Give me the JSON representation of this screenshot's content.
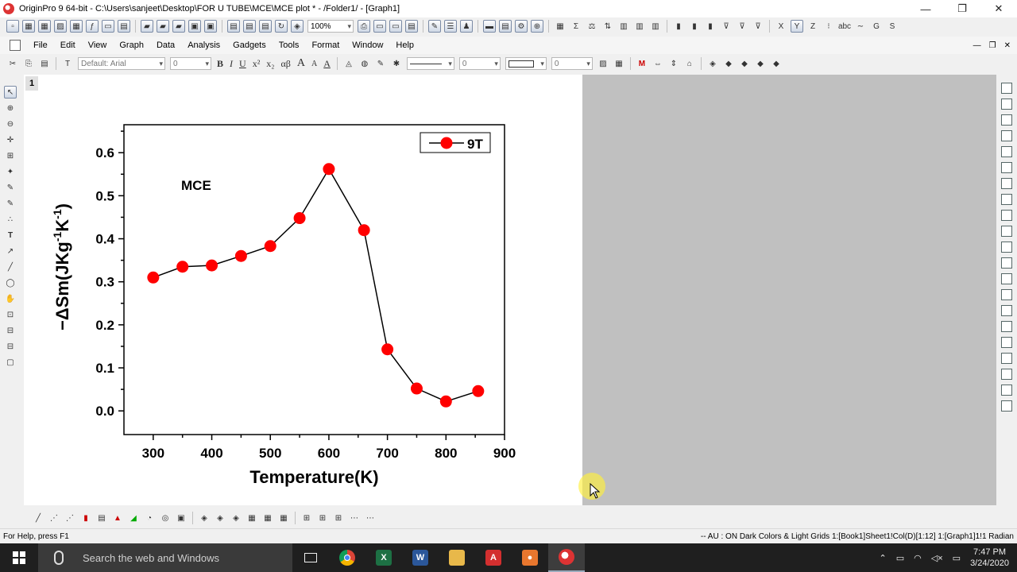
{
  "window": {
    "title": "OriginPro 9 64-bit - C:\\Users\\sanjeet\\Desktop\\FOR U TUBE\\MCE\\MCE plot * - /Folder1/ - [Graph1]",
    "minimize": "—",
    "restore": "❐",
    "close": "✕"
  },
  "toolbar": {
    "zoom": "100%"
  },
  "menu": [
    "File",
    "Edit",
    "View",
    "Graph",
    "Data",
    "Analysis",
    "Gadgets",
    "Tools",
    "Format",
    "Window",
    "Help"
  ],
  "format_bar": {
    "font": "Default: Arial",
    "font_size": "0",
    "line_width": "0",
    "border_width": "0",
    "bold": "B",
    "italic": "I",
    "underline": "U",
    "superscript": "x²",
    "subscript": "x₂",
    "greek": "αβ",
    "grow_font": "A",
    "shrink_font": "A"
  },
  "graph_tab": {
    "layer_number": "1"
  },
  "chart_data": {
    "type": "line",
    "title": "",
    "annotation": "MCE",
    "xlabel": "Temperature(K)",
    "ylabel": "−ΔSm(JKg",
    "ylabel_sup1": "-1",
    "ylabel_mid": "K",
    "ylabel_sup2": "-1",
    "ylabel_end": ")",
    "xlim": [
      250,
      900
    ],
    "ylim": [
      -0.055,
      0.665
    ],
    "xticks": [
      300,
      400,
      500,
      600,
      700,
      800,
      900
    ],
    "yticks": [
      0.0,
      0.1,
      0.2,
      0.3,
      0.4,
      0.5,
      0.6
    ],
    "grid": false,
    "legend_position": "top-right",
    "series": [
      {
        "name": "9T",
        "color": "#ff0000",
        "marker": "circle",
        "x": [
          300,
          350,
          400,
          450,
          500,
          550,
          600,
          660,
          700,
          750,
          800,
          855
        ],
        "y": [
          0.31,
          0.335,
          0.338,
          0.36,
          0.383,
          0.448,
          0.562,
          0.42,
          0.143,
          0.052,
          0.022,
          0.046
        ]
      }
    ]
  },
  "status": {
    "help": "For Help, press F1",
    "info": "-- AU : ON  Dark Colors & Light Grids  1:[Book1]Sheet1!Col(D)[1:12]  1:[Graph1]1!1  Radian"
  },
  "taskbar": {
    "search_placeholder": "Search the web and Windows",
    "time": "7:47 PM",
    "date": "3/24/2020"
  }
}
